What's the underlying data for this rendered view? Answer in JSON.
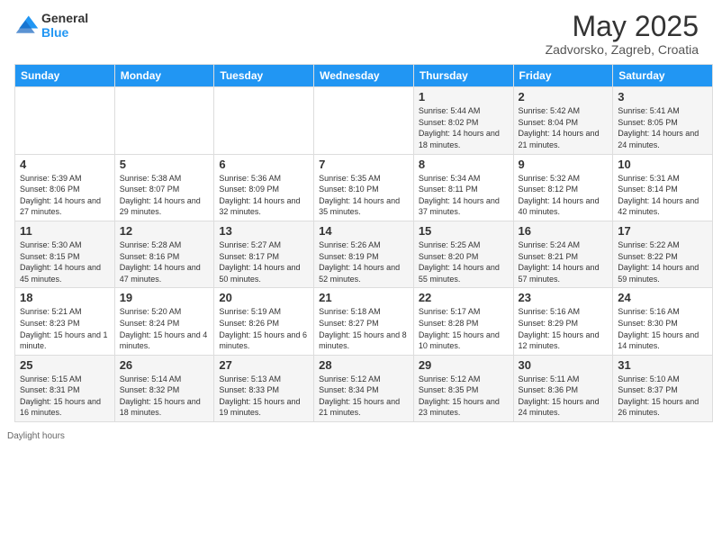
{
  "header": {
    "logo": {
      "general": "General",
      "blue": "Blue"
    },
    "month": "May 2025",
    "location": "Zadvorsko, Zagreb, Croatia"
  },
  "days_of_week": [
    "Sunday",
    "Monday",
    "Tuesday",
    "Wednesday",
    "Thursday",
    "Friday",
    "Saturday"
  ],
  "weeks": [
    [
      {
        "day": "",
        "info": ""
      },
      {
        "day": "",
        "info": ""
      },
      {
        "day": "",
        "info": ""
      },
      {
        "day": "",
        "info": ""
      },
      {
        "day": "1",
        "info": "Sunrise: 5:44 AM\nSunset: 8:02 PM\nDaylight: 14 hours and 18 minutes."
      },
      {
        "day": "2",
        "info": "Sunrise: 5:42 AM\nSunset: 8:04 PM\nDaylight: 14 hours and 21 minutes."
      },
      {
        "day": "3",
        "info": "Sunrise: 5:41 AM\nSunset: 8:05 PM\nDaylight: 14 hours and 24 minutes."
      }
    ],
    [
      {
        "day": "4",
        "info": "Sunrise: 5:39 AM\nSunset: 8:06 PM\nDaylight: 14 hours and 27 minutes."
      },
      {
        "day": "5",
        "info": "Sunrise: 5:38 AM\nSunset: 8:07 PM\nDaylight: 14 hours and 29 minutes."
      },
      {
        "day": "6",
        "info": "Sunrise: 5:36 AM\nSunset: 8:09 PM\nDaylight: 14 hours and 32 minutes."
      },
      {
        "day": "7",
        "info": "Sunrise: 5:35 AM\nSunset: 8:10 PM\nDaylight: 14 hours and 35 minutes."
      },
      {
        "day": "8",
        "info": "Sunrise: 5:34 AM\nSunset: 8:11 PM\nDaylight: 14 hours and 37 minutes."
      },
      {
        "day": "9",
        "info": "Sunrise: 5:32 AM\nSunset: 8:12 PM\nDaylight: 14 hours and 40 minutes."
      },
      {
        "day": "10",
        "info": "Sunrise: 5:31 AM\nSunset: 8:14 PM\nDaylight: 14 hours and 42 minutes."
      }
    ],
    [
      {
        "day": "11",
        "info": "Sunrise: 5:30 AM\nSunset: 8:15 PM\nDaylight: 14 hours and 45 minutes."
      },
      {
        "day": "12",
        "info": "Sunrise: 5:28 AM\nSunset: 8:16 PM\nDaylight: 14 hours and 47 minutes."
      },
      {
        "day": "13",
        "info": "Sunrise: 5:27 AM\nSunset: 8:17 PM\nDaylight: 14 hours and 50 minutes."
      },
      {
        "day": "14",
        "info": "Sunrise: 5:26 AM\nSunset: 8:19 PM\nDaylight: 14 hours and 52 minutes."
      },
      {
        "day": "15",
        "info": "Sunrise: 5:25 AM\nSunset: 8:20 PM\nDaylight: 14 hours and 55 minutes."
      },
      {
        "day": "16",
        "info": "Sunrise: 5:24 AM\nSunset: 8:21 PM\nDaylight: 14 hours and 57 minutes."
      },
      {
        "day": "17",
        "info": "Sunrise: 5:22 AM\nSunset: 8:22 PM\nDaylight: 14 hours and 59 minutes."
      }
    ],
    [
      {
        "day": "18",
        "info": "Sunrise: 5:21 AM\nSunset: 8:23 PM\nDaylight: 15 hours and 1 minute."
      },
      {
        "day": "19",
        "info": "Sunrise: 5:20 AM\nSunset: 8:24 PM\nDaylight: 15 hours and 4 minutes."
      },
      {
        "day": "20",
        "info": "Sunrise: 5:19 AM\nSunset: 8:26 PM\nDaylight: 15 hours and 6 minutes."
      },
      {
        "day": "21",
        "info": "Sunrise: 5:18 AM\nSunset: 8:27 PM\nDaylight: 15 hours and 8 minutes."
      },
      {
        "day": "22",
        "info": "Sunrise: 5:17 AM\nSunset: 8:28 PM\nDaylight: 15 hours and 10 minutes."
      },
      {
        "day": "23",
        "info": "Sunrise: 5:16 AM\nSunset: 8:29 PM\nDaylight: 15 hours and 12 minutes."
      },
      {
        "day": "24",
        "info": "Sunrise: 5:16 AM\nSunset: 8:30 PM\nDaylight: 15 hours and 14 minutes."
      }
    ],
    [
      {
        "day": "25",
        "info": "Sunrise: 5:15 AM\nSunset: 8:31 PM\nDaylight: 15 hours and 16 minutes."
      },
      {
        "day": "26",
        "info": "Sunrise: 5:14 AM\nSunset: 8:32 PM\nDaylight: 15 hours and 18 minutes."
      },
      {
        "day": "27",
        "info": "Sunrise: 5:13 AM\nSunset: 8:33 PM\nDaylight: 15 hours and 19 minutes."
      },
      {
        "day": "28",
        "info": "Sunrise: 5:12 AM\nSunset: 8:34 PM\nDaylight: 15 hours and 21 minutes."
      },
      {
        "day": "29",
        "info": "Sunrise: 5:12 AM\nSunset: 8:35 PM\nDaylight: 15 hours and 23 minutes."
      },
      {
        "day": "30",
        "info": "Sunrise: 5:11 AM\nSunset: 8:36 PM\nDaylight: 15 hours and 24 minutes."
      },
      {
        "day": "31",
        "info": "Sunrise: 5:10 AM\nSunset: 8:37 PM\nDaylight: 15 hours and 26 minutes."
      }
    ]
  ],
  "footer": {
    "daylight_label": "Daylight hours"
  }
}
